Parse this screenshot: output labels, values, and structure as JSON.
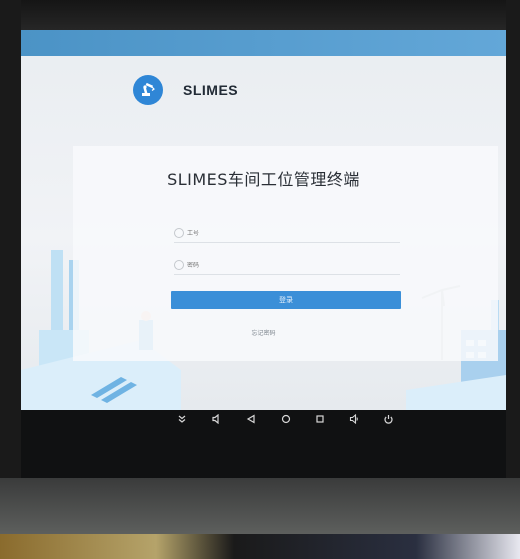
{
  "app": {
    "brand_name": "SLIMES",
    "logo_icon": "robot-arm-icon",
    "accent_color": "#3b8fd8",
    "topbar_color": "#5aa0d2"
  },
  "login": {
    "title": "SLIMES车间工位管理终端",
    "field1_placeholder": "工号",
    "field2_placeholder": "密码",
    "login_button": "登录",
    "forgot_password": "忘记密码"
  },
  "navbar": {
    "icons": [
      "chevrons-down-icon",
      "volume-down-icon",
      "back-icon",
      "home-icon",
      "recents-icon",
      "volume-up-icon",
      "power-icon"
    ]
  }
}
